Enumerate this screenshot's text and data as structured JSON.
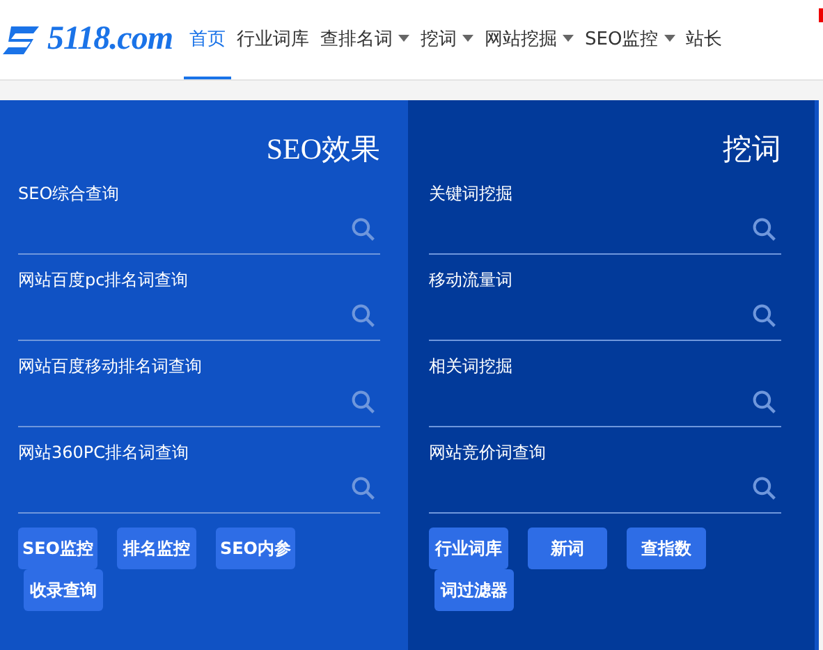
{
  "header": {
    "logo_text": "5118.com",
    "nav": [
      {
        "label": "首页",
        "selected": true,
        "dropdown": false
      },
      {
        "label": "行业词库",
        "selected": false,
        "dropdown": false
      },
      {
        "label": "查排名词",
        "selected": false,
        "dropdown": true
      },
      {
        "label": "挖词",
        "selected": false,
        "dropdown": true
      },
      {
        "label": "网站挖掘",
        "selected": false,
        "dropdown": true
      },
      {
        "label": "SEO监控",
        "selected": false,
        "dropdown": true
      },
      {
        "label": "站长",
        "selected": false,
        "dropdown": false
      }
    ]
  },
  "panels": [
    {
      "title": "SEO效果",
      "fields": [
        "SEO综合查询",
        "网站百度pc排名词查询",
        "网站百度移动排名词查询",
        "网站360PC排名词查询"
      ],
      "buttons": [
        "SEO监控",
        "排名监控",
        "SEO内参",
        "收录查询"
      ]
    },
    {
      "title": "挖词",
      "fields": [
        "关键词挖掘",
        "移动流量词",
        "相关词挖掘",
        "网站竞价词查询"
      ],
      "buttons": [
        "行业词库",
        "新词",
        "查指数",
        "词过滤器"
      ]
    }
  ]
}
